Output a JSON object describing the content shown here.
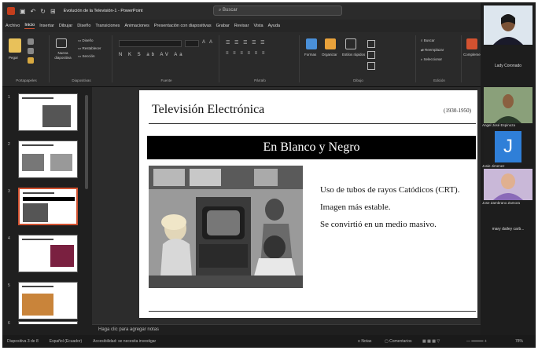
{
  "app": {
    "doc_title": "Evolución de la Televisión-1 - PowerPoint",
    "search_placeholder": "Buscar"
  },
  "menu": [
    "Archivo",
    "Inicio",
    "Insertar",
    "Dibujar",
    "Diseño",
    "Transiciones",
    "Animaciones",
    "Presentación con diapositivas",
    "Grabar",
    "Revisar",
    "Vista",
    "Ayuda"
  ],
  "ribbon": {
    "paste": "Pegar",
    "new_slide": "Nueva diapositiva",
    "layout": "Diseño",
    "reset": "Restablecer",
    "section": "Sección",
    "format_buttons": "N K S ab AV Aa",
    "forms": "Formas",
    "arrange": "Organizar",
    "quick_styles": "Estilos rápidos",
    "find": "Buscar",
    "replace": "Reemplazar",
    "select": "Seleccionar",
    "designer": "Complementos",
    "groups": [
      "Portapapeles",
      "Diapositivas",
      "Fuente",
      "Párrafo",
      "Dibujo",
      "Edición",
      "Complementos"
    ]
  },
  "thumbnails": [
    "1",
    "2",
    "3",
    "4",
    "5",
    "6"
  ],
  "slide": {
    "title": "Televisión Electrónica",
    "years": "(1930-1950)",
    "subtitle": "En Blanco y Negro",
    "bullets": [
      "Uso de tubos de rayos Catódicos (CRT).",
      "Imagen más estable.",
      "Se convirtió en un medio masivo."
    ]
  },
  "notes_placeholder": "Haga clic para agregar notas",
  "status": {
    "slide_info": "Diapositiva 3 de 8",
    "language": "Español (Ecuador)",
    "accessibility": "Accesibilidad: se necesita investigar",
    "notes": "Notas",
    "comments": "Comentarios",
    "zoom": "78%"
  },
  "call": {
    "participants": [
      {
        "name": "Lady Coronado"
      },
      {
        "name": "Angel José Espinoza"
      },
      {
        "name": "Josie Jimenez",
        "initial": "J"
      },
      {
        "name": "Jose Zambrano Zamora"
      },
      {
        "name": "mary dailey carb..."
      }
    ]
  }
}
